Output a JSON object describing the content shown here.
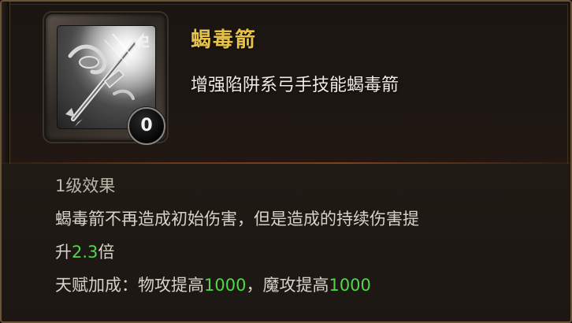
{
  "skill": {
    "name": "蝎毒箭",
    "description": "增强陷阱系弓手技能蝎毒箭",
    "level_badge": "0",
    "icon": "scorpion-arrow-skill-icon"
  },
  "effect": {
    "heading": "1级效果",
    "line1": "蝎毒箭不再造成初始伤害，但是造成的持续伤害提",
    "line2_prefix": "升",
    "line2_value": "2.3",
    "line2_suffix": "倍",
    "bonus_prefix": "天赋加成：物攻提高",
    "bonus_phys_value": "1000",
    "bonus_mid": "，魔攻提高",
    "bonus_magic_value": "1000"
  },
  "colors": {
    "title": "#e6c24a",
    "highlight_number": "#52d64a",
    "text": "#d8d2c8"
  }
}
